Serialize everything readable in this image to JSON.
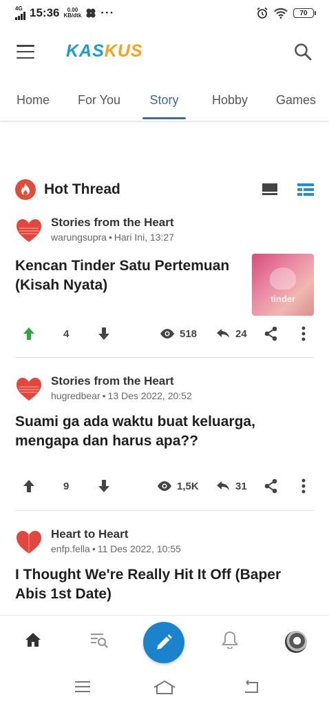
{
  "status_bar": {
    "network": "4G",
    "time": "15:36",
    "speed_value": "0.00",
    "speed_unit": "KB/dtk",
    "more": "···",
    "battery": "70"
  },
  "header": {
    "logo_part1": "KAS",
    "logo_part2": "KUS",
    "brand_blue": "#1c9bd6",
    "brand_orange": "#f7a21b"
  },
  "tabs": [
    {
      "label": "Home",
      "active": false
    },
    {
      "label": "For You",
      "active": false
    },
    {
      "label": "Story",
      "active": true
    },
    {
      "label": "Hobby",
      "active": false
    },
    {
      "label": "Games",
      "active": false
    }
  ],
  "section": {
    "title": "Hot Thread",
    "icon": "fire-icon",
    "accent": "#e04e39"
  },
  "threads": [
    {
      "community": "Stories from the Heart",
      "user": "warungsupra",
      "time": "Hari Ini, 13:27",
      "title": "Kencan Tinder Satu Pertemuan (Kisah Nyata)",
      "thumbnail_text": "tinder",
      "upvotes": "4",
      "upvoted": true,
      "views": "518",
      "replies": "24"
    },
    {
      "community": "Stories from the Heart",
      "user": "hugredbear",
      "time": "13 Des 2022, 20:52",
      "title": "Suami ga ada waktu buat keluarga, mengapa dan harus apa??",
      "upvotes": "9",
      "upvoted": false,
      "views": "1,5K",
      "replies": "31"
    },
    {
      "community": "Heart to Heart",
      "user": "enfp.fella",
      "time": "11 Des 2022, 10:55",
      "title": "I Thought We're Really Hit It Off (Baper Abis 1st Date)"
    }
  ],
  "meta_separator": "•",
  "bottom_nav": {
    "items": [
      "home-icon",
      "search-thread-icon",
      "create-post-icon",
      "bell-icon",
      "avatar"
    ],
    "accent": "#1b83cc"
  }
}
